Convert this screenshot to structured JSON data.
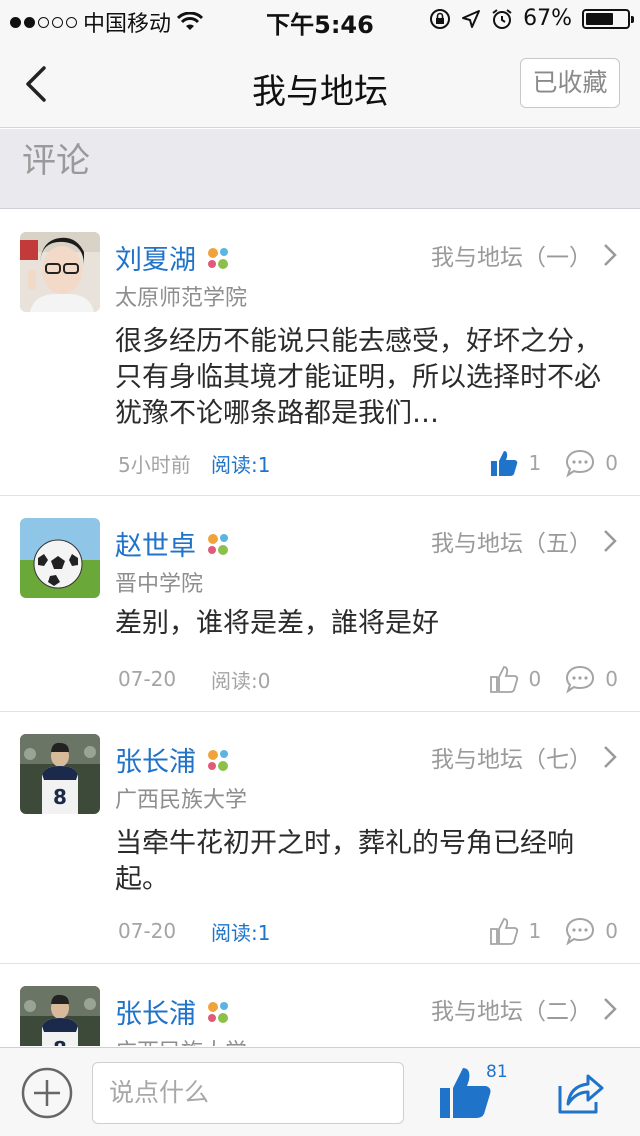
{
  "status_bar": {
    "carrier": "中国移动",
    "time": "下午5:46",
    "battery": "67%",
    "battery_level": 0.67
  },
  "nav": {
    "title": "我与地坛",
    "favorite_label": "已收藏"
  },
  "section": {
    "title": "评论"
  },
  "comments": [
    {
      "name": "刘夏湖",
      "school": "太原师范学院",
      "forum": "我与地坛（一）",
      "content": "很多经历不能说只能去感受，好坏之分，只有身临其境才能证明，所以选择时不必犹豫不论哪条路都是我们…",
      "time": "5小时前",
      "reads": "阅读:1",
      "likes": "1",
      "replies": "0",
      "liked": true
    },
    {
      "name": "赵世卓",
      "school": "晋中学院",
      "forum": "我与地坛（五）",
      "content": "差别，谁将是差，誰将是好",
      "time": "07-20",
      "reads": "阅读:0",
      "likes": "0",
      "replies": "0",
      "liked": false
    },
    {
      "name": "张长浦",
      "school": "广西民族大学",
      "forum": "我与地坛（七）",
      "content": "当牵牛花初开之时，葬礼的号角已经响起。",
      "time": "07-20",
      "reads": "阅读:1",
      "likes": "1",
      "replies": "0",
      "liked": false
    },
    {
      "name": "张长浦",
      "school": "广西民族大学",
      "forum": "我与地坛（二）"
    }
  ],
  "bottom_bar": {
    "input_placeholder": "说点什么",
    "like_count": "81"
  },
  "colors": {
    "accent": "#1f73c8",
    "muted": "#9a9a9a",
    "section_bg": "#e9e9ee"
  }
}
